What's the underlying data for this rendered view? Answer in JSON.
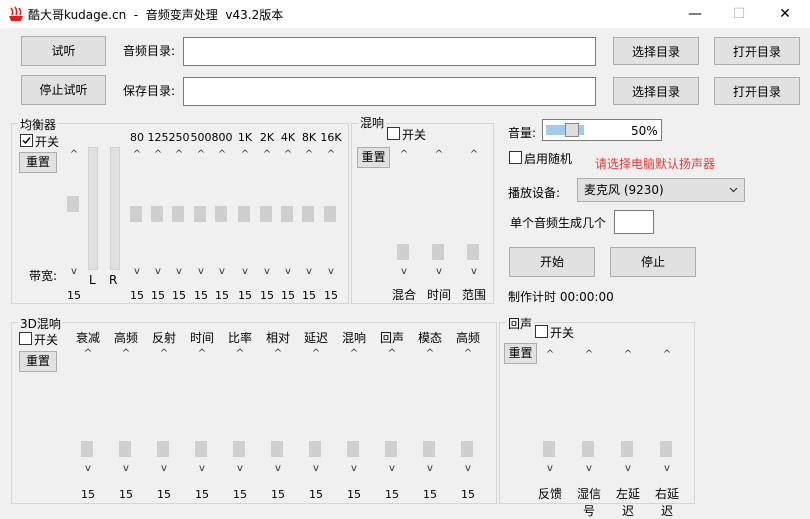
{
  "window": {
    "title": "酷大哥kudage.cn  -  音频变声处理  v43.2版本",
    "minimize": "—",
    "maximize": "☐",
    "close": "✕"
  },
  "top": {
    "listen": "试听",
    "stop_listen": "停止试听",
    "audio_dir_label": "音频目录:",
    "save_dir_label": "保存目录:",
    "audio_dir_value": "",
    "save_dir_value": "",
    "choose_dir_1": "选择目录",
    "open_dir_1": "打开目录",
    "choose_dir_2": "选择目录",
    "open_dir_2": "打开目录"
  },
  "equalizer": {
    "title": "均衡器",
    "toggle_label": "开关",
    "toggle_checked": true,
    "reset": "重置",
    "bandwidth_label": "带宽:",
    "bandwidth_value": "15",
    "lr": [
      "L",
      "R"
    ],
    "bands": [
      {
        "label": "80",
        "value": "15"
      },
      {
        "label": "125",
        "value": "15"
      },
      {
        "label": "250",
        "value": "15"
      },
      {
        "label": "500",
        "value": "15"
      },
      {
        "label": "800",
        "value": "15"
      },
      {
        "label": "1K",
        "value": "15"
      },
      {
        "label": "2K",
        "value": "15"
      },
      {
        "label": "4K",
        "value": "15"
      },
      {
        "label": "8K",
        "value": "15"
      },
      {
        "label": "16K",
        "value": "15"
      }
    ]
  },
  "reverb": {
    "title": "混响",
    "toggle_label": "开关",
    "reset": "重置",
    "sliders": [
      "混合",
      "时间",
      "范围"
    ]
  },
  "volume": {
    "label": "音量:",
    "value": "50%",
    "level": 0.5
  },
  "random": {
    "label": "启用随机",
    "checked": false
  },
  "speaker_hint": "请选择电脑默认扬声器",
  "device": {
    "label": "播放设备:",
    "selected": "麦克风 (9230)"
  },
  "per_file": {
    "label": "单个音频生成几个",
    "value": ""
  },
  "start": "开始",
  "stop": "停止",
  "timer": "制作计时 00:00:00",
  "reverb3d": {
    "title": "3D混响",
    "toggle_label": "开关",
    "reset": "重置",
    "sliders": [
      {
        "label": "衰减",
        "value": "15"
      },
      {
        "label": "高频",
        "value": "15"
      },
      {
        "label": "反射",
        "value": "15"
      },
      {
        "label": "时间",
        "value": "15"
      },
      {
        "label": "比率",
        "value": "15"
      },
      {
        "label": "相对",
        "value": "15"
      },
      {
        "label": "延迟",
        "value": "15"
      },
      {
        "label": "混响",
        "value": "15"
      },
      {
        "label": "回声",
        "value": "15"
      },
      {
        "label": "模态",
        "value": "15"
      },
      {
        "label": "高频",
        "value": "15"
      }
    ]
  },
  "echo": {
    "title": "回声",
    "toggle_label": "开关",
    "reset": "重置",
    "sliders": [
      "反馈",
      "湿信号",
      "左延迟",
      "右延迟"
    ]
  },
  "colors": {
    "accent": "#e53b3b",
    "logo": "#e02020"
  }
}
